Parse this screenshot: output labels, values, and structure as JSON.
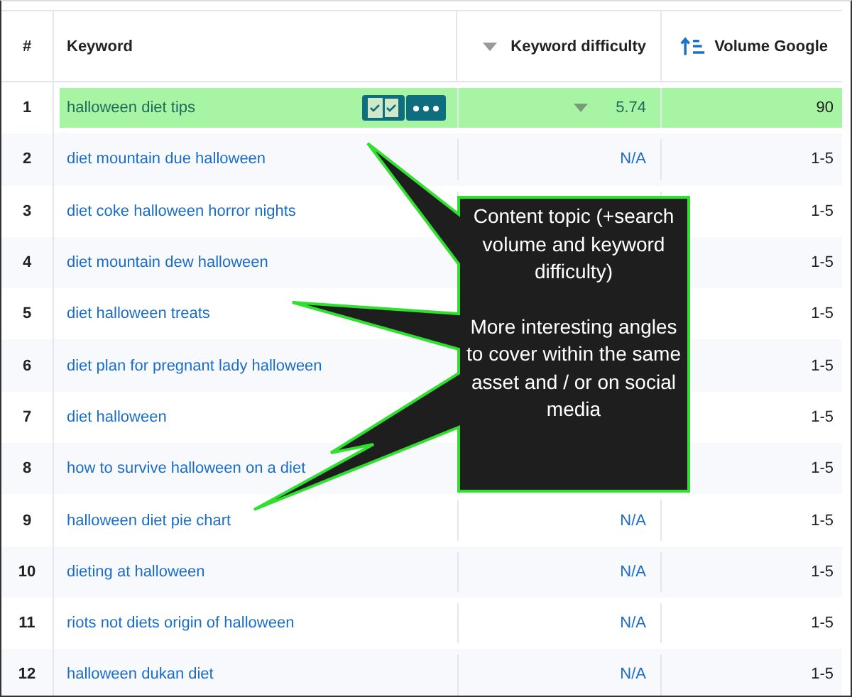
{
  "table": {
    "columns": [
      "#",
      "Keyword",
      "Keyword difficulty",
      "Volume Google"
    ],
    "rows": [
      {
        "index": "1",
        "keyword": "halloween diet tips",
        "difficulty": "5.74",
        "volume": "90",
        "selected": true
      },
      {
        "index": "2",
        "keyword": "diet mountain due halloween",
        "difficulty": "N/A",
        "volume": "1-5",
        "selected": false
      },
      {
        "index": "3",
        "keyword": "diet coke halloween horror nights",
        "volume": "1-5",
        "selected": false
      },
      {
        "index": "4",
        "keyword": "diet mountain dew halloween",
        "volume": "1-5",
        "selected": false
      },
      {
        "index": "5",
        "keyword": "diet halloween treats",
        "volume": "1-5",
        "selected": false
      },
      {
        "index": "6",
        "keyword": "diet plan for pregnant lady halloween",
        "volume": "1-5",
        "selected": false
      },
      {
        "index": "7",
        "keyword": "diet halloween",
        "volume": "1-5",
        "selected": false
      },
      {
        "index": "8",
        "keyword": "how to survive halloween on a diet",
        "volume": "1-5",
        "selected": false
      },
      {
        "index": "9",
        "keyword": "halloween diet pie chart",
        "difficulty": "N/A",
        "volume": "1-5",
        "selected": false
      },
      {
        "index": "10",
        "keyword": "dieting at halloween",
        "difficulty": "N/A",
        "volume": "1-5",
        "selected": false
      },
      {
        "index": "11",
        "keyword": "riots not diets origin of halloween",
        "difficulty": "N/A",
        "volume": "1-5",
        "selected": false
      },
      {
        "index": "12",
        "keyword": "halloween dukan diet",
        "difficulty": "N/A",
        "volume": "1-5",
        "selected": false
      }
    ]
  },
  "callout": {
    "paragraphs": [
      "Content topic (+search volume and keyword difficulty)",
      "More interesting angles to cover within the same asset and / or on social media"
    ]
  }
}
